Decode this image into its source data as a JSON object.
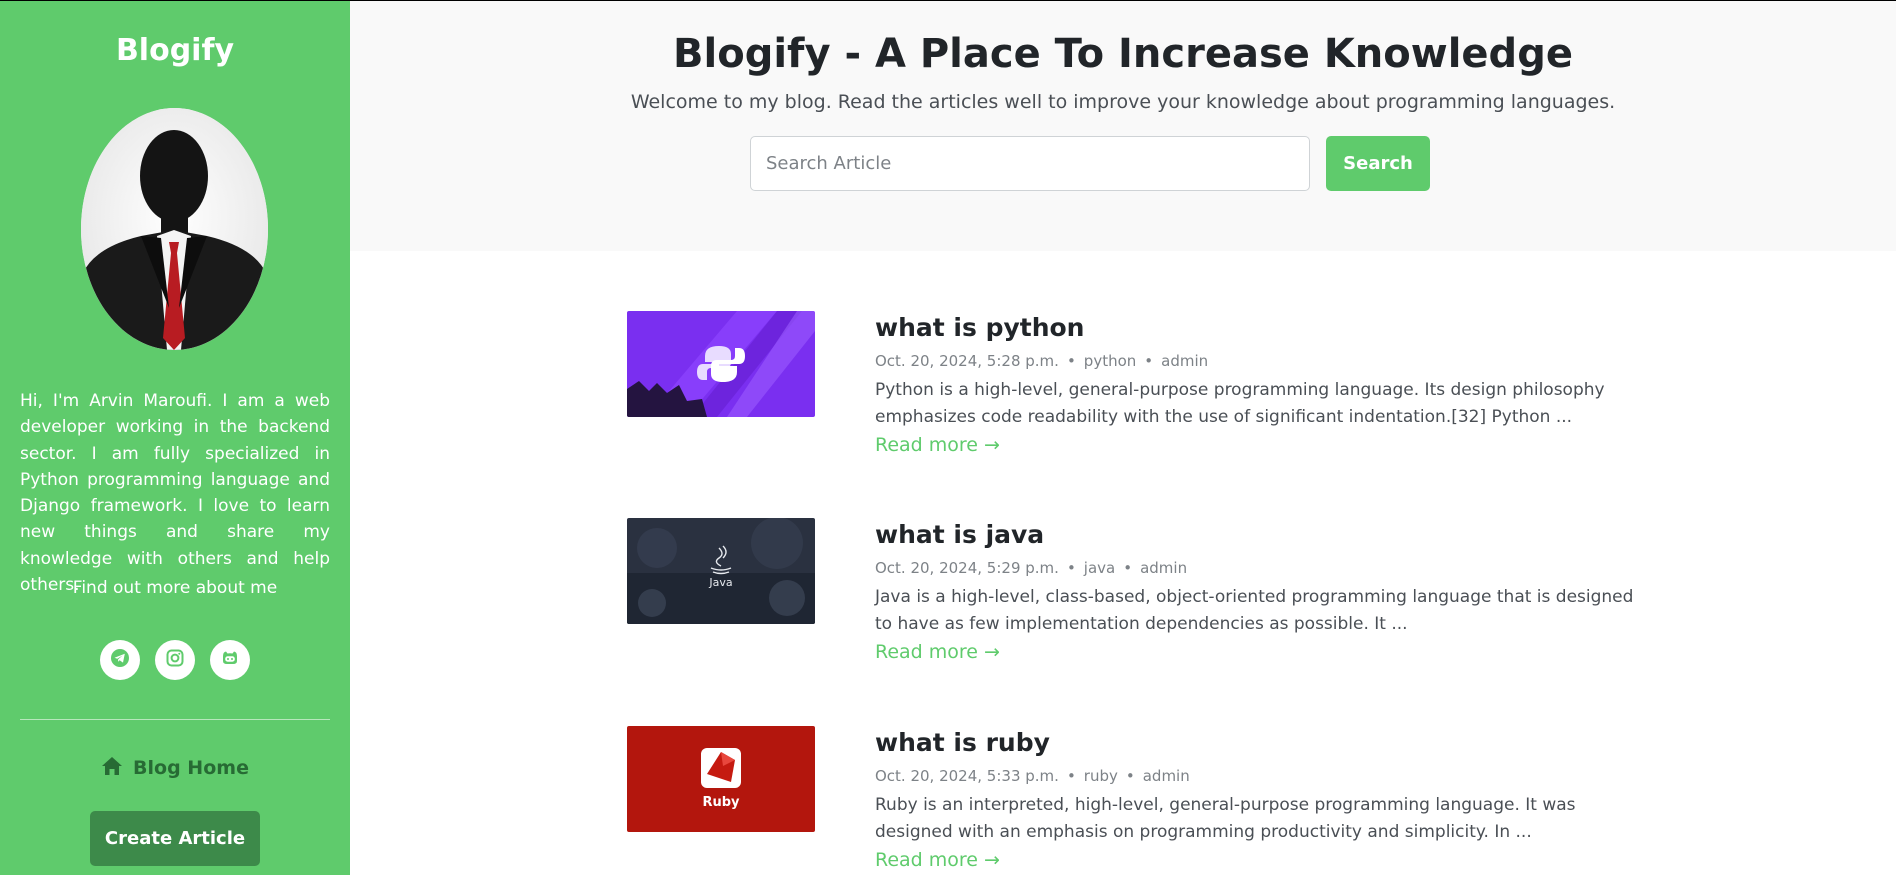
{
  "sidebar": {
    "brand": "Blogify",
    "bio": "Hi, I'm Arvin Maroufi. I am a web developer working in the backend sector. I am fully specialized in Python programming language and Django framework. I love to learn new things and share my knowledge with others and help others.",
    "more_link": "Find out more about me",
    "socials": [
      "telegram-icon",
      "instagram-icon",
      "github-icon"
    ],
    "home_label": "Blog Home",
    "create_label": "Create Article"
  },
  "header": {
    "title": "Blogify - A Place To Increase Knowledge",
    "subtitle": "Welcome to my blog. Read the articles well to improve your knowledge about programming languages.",
    "search_placeholder": "Search Article",
    "search_button": "Search"
  },
  "posts": [
    {
      "title": "what is python",
      "date": "Oct. 20, 2024, 5:28 p.m.",
      "category": "python",
      "author": "admin",
      "excerpt": "Python is a high-level, general-purpose programming language. Its design philosophy emphasizes code readability with the use of significant indentation.[32] Python ...",
      "read_more": "Read more →"
    },
    {
      "title": "what is java",
      "date": "Oct. 20, 2024, 5:29 p.m.",
      "category": "java",
      "author": "admin",
      "excerpt": "Java is a high-level, class-based, object-oriented programming language that is designed to have as few implementation dependencies as possible. It ...",
      "read_more": "Read more →",
      "thumb_label": "Java"
    },
    {
      "title": "what is ruby",
      "date": "Oct. 20, 2024, 5:33 p.m.",
      "category": "ruby",
      "author": "admin",
      "excerpt": "Ruby is an interpreted, high-level, general-purpose programming language. It was designed with an emphasis on programming productivity and simplicity. In ...",
      "read_more": "Read more →",
      "thumb_label": "Ruby"
    }
  ],
  "colors": {
    "accent": "#5fcb6c",
    "accent_dark": "#3d8a4a",
    "home_link": "#276b34",
    "header_bg": "#f9f9f9"
  }
}
